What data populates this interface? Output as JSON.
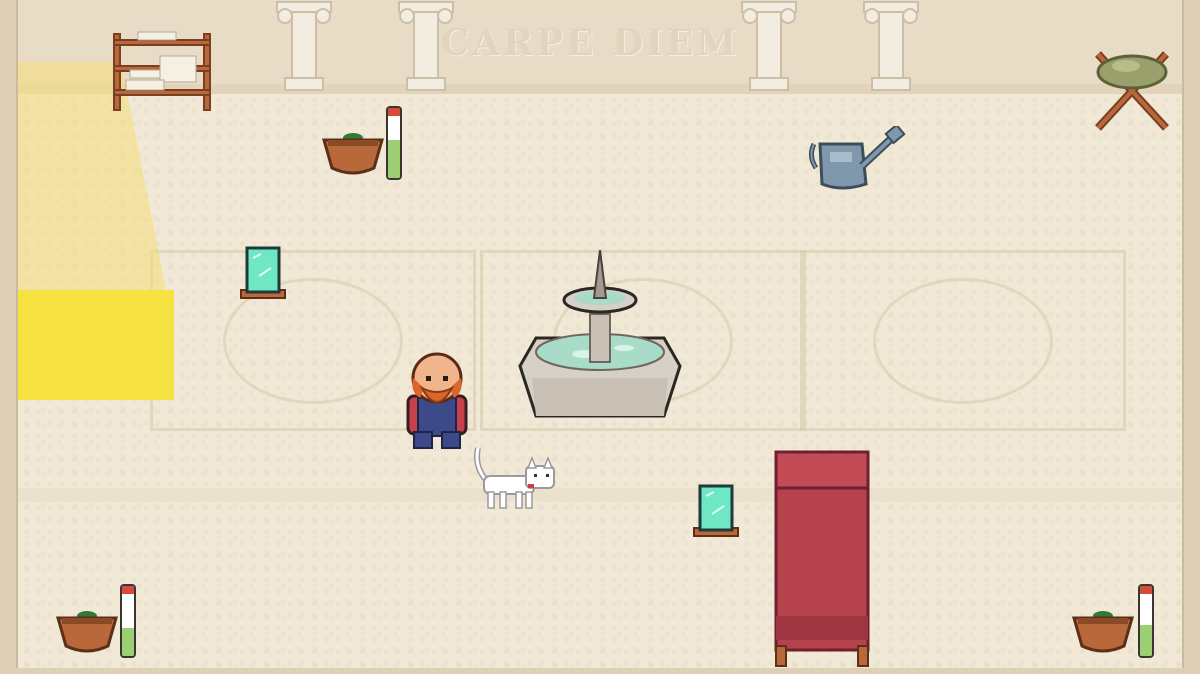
{
  "wall": {
    "inscription": "CARPE DIEM"
  },
  "plants": [
    {
      "id": "plant-top",
      "water_level": 0.55
    },
    {
      "id": "plant-bottom-left",
      "water_level": 0.4
    },
    {
      "id": "plant-bottom-right",
      "water_level": 0.45
    }
  ],
  "colors": {
    "floor": "#f1e8d6",
    "wall": "#e8dcc6",
    "sunlight": "#f6e342",
    "carpet_red": "#b5424c",
    "crystal": "#6fe6c4",
    "meter_green": "#9ccf72",
    "meter_red": "#d24b3b"
  },
  "icons": [
    "shelf-icon",
    "column-icon",
    "cactus-stand-icon",
    "plant-pot-icon",
    "watering-can-icon",
    "crystal-frame-icon",
    "fountain-icon",
    "player-character-icon",
    "cat-icon",
    "red-bench-icon"
  ]
}
